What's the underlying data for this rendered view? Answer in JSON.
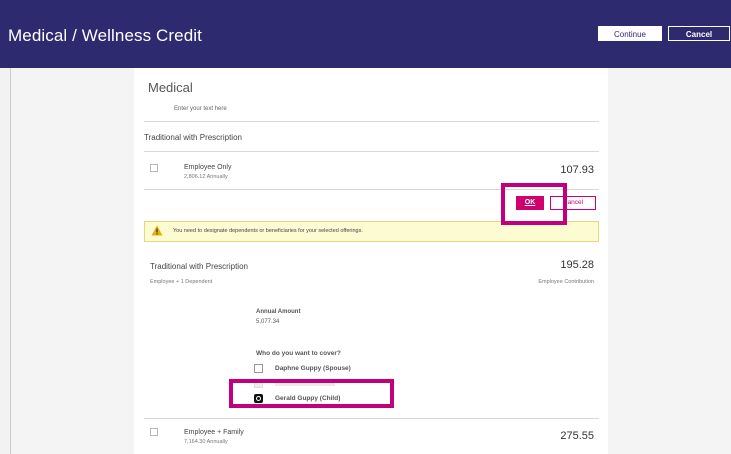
{
  "header": {
    "title": "Medical / Wellness Credit",
    "continue_label": "Continue",
    "cancel_label": "Cancel",
    "background": "#2e2a6f"
  },
  "section": {
    "title": "Medical",
    "placeholder": "Enter your text here"
  },
  "plan_group": {
    "name": "Traditional with Prescription"
  },
  "options": [
    {
      "label": "Employee Only",
      "sub": "2,806.12  Annually",
      "price": "107.93",
      "checked": false
    },
    {
      "label": "Employee + Family",
      "sub": "7,164.30  Annually",
      "price": "275.55",
      "checked": false
    }
  ],
  "actions": {
    "ok_label": "OK",
    "cancel_label": "Cancel",
    "accent": "#d1006f"
  },
  "warning": {
    "text": "You need to designate dependents or beneficiaries for your selected offerings.",
    "icon": "warning-triangle-icon"
  },
  "selected": {
    "name": "Traditional with Prescription",
    "sub": "Employee + 1 Dependent",
    "price": "195.28",
    "contribution_label": "Employee Contribution",
    "annual_label": "Annual Amount",
    "annual_value": "5,077.34",
    "cover_question": "Who do you want to cover?",
    "dependents": [
      {
        "label": "Daphne Guppy (Spouse)",
        "checked": false
      },
      {
        "label": "Gerald Guppy (Child)",
        "checked": true
      }
    ]
  },
  "highlight_color": "#c2007c"
}
